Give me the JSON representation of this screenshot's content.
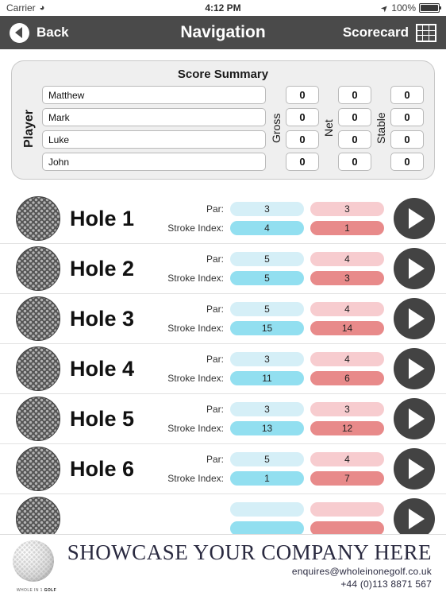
{
  "status_bar": {
    "carrier": "Carrier",
    "wifi_icon": "wifi-icon",
    "time": "4:12 PM",
    "location_icon": "location-arrow-icon",
    "battery_percent": "100%",
    "battery_icon": "battery-icon"
  },
  "nav_bar": {
    "back_label": "Back",
    "back_icon": "back-circle-arrow-icon",
    "title": "Navigation",
    "scorecard_label": "Scorecard",
    "scorecard_icon": "grid-table-icon"
  },
  "summary": {
    "title": "Score Summary",
    "player_label": "Player",
    "gross_label": "Gross",
    "net_label": "Net",
    "stable_label": "Stable",
    "players": [
      {
        "name": "Matthew",
        "gross": "0",
        "net": "0",
        "stable": "0"
      },
      {
        "name": "Mark",
        "gross": "0",
        "net": "0",
        "stable": "0"
      },
      {
        "name": "Luke",
        "gross": "0",
        "net": "0",
        "stable": "0"
      },
      {
        "name": "John",
        "gross": "0",
        "net": "0",
        "stable": "0"
      }
    ]
  },
  "holes": {
    "par_label": "Par:",
    "stroke_index_label": "Stroke Index:",
    "ball_icon": "golf-ball-icon",
    "play_icon": "play-arrow-icon",
    "rows": [
      {
        "name": "Hole 1",
        "blue_par": "3",
        "blue_si": "4",
        "pink_par": "3",
        "pink_si": "1"
      },
      {
        "name": "Hole 2",
        "blue_par": "5",
        "blue_si": "5",
        "pink_par": "4",
        "pink_si": "3"
      },
      {
        "name": "Hole 3",
        "blue_par": "5",
        "blue_si": "15",
        "pink_par": "4",
        "pink_si": "14"
      },
      {
        "name": "Hole 4",
        "blue_par": "3",
        "blue_si": "11",
        "pink_par": "4",
        "pink_si": "6"
      },
      {
        "name": "Hole 5",
        "blue_par": "3",
        "blue_si": "13",
        "pink_par": "3",
        "pink_si": "12"
      },
      {
        "name": "Hole 6",
        "blue_par": "5",
        "blue_si": "1",
        "pink_par": "4",
        "pink_si": "7"
      }
    ]
  },
  "ad_banner": {
    "headline": "SHOWCASE YOUR COMPANY HERE",
    "email": "enquires@wholeinonegolf.co.uk",
    "phone": "+44 (0)113 8871 567",
    "logo_text_prefix": "WHOLE IN 1 ",
    "logo_text_bold": "GOLF",
    "logo_icon": "golf-ball-logo-icon"
  },
  "colors": {
    "nav_bar": "#4a4a4a",
    "par_blue": "#d5eff7",
    "stroke_blue": "#92dff0",
    "par_pink": "#f7cccf",
    "stroke_red": "#e88a8a",
    "play_button": "#434343",
    "ad_navy": "#2a2a40"
  }
}
